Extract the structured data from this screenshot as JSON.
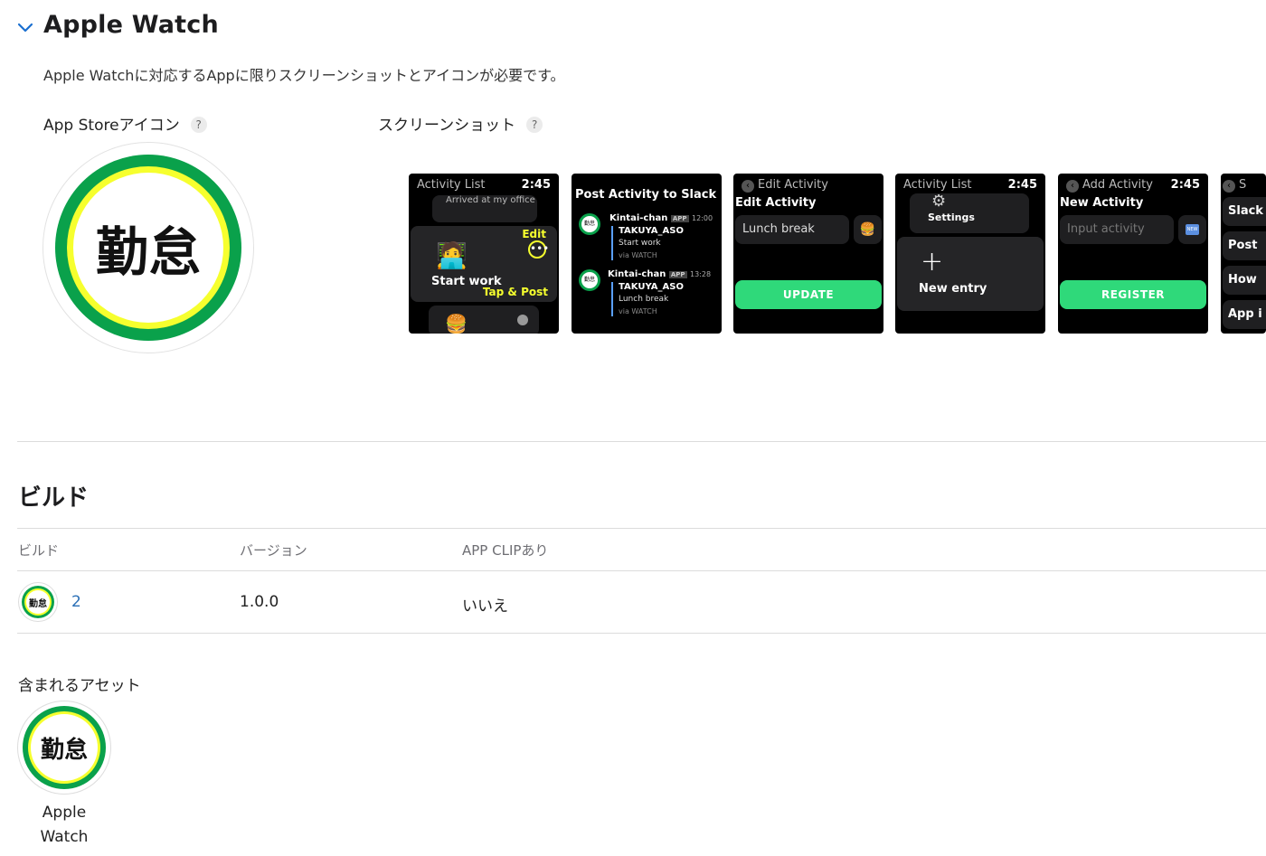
{
  "section": {
    "title": "Apple Watch",
    "description": "Apple Watchに対応するAppに限りスクリーンショットとアイコンが必要です。",
    "app_store_icon_label": "App Storeアイコン",
    "screenshots_label": "スクリーンショット",
    "help": "?"
  },
  "icon": {
    "glyphs": "勤怠",
    "colors": {
      "ring": "#0aa14b",
      "glow": "#f6ff2e"
    }
  },
  "screenshots": [
    {
      "title": "Activity List",
      "time": "2:45",
      "card_top": "Arrived at my office",
      "edit": "Edit",
      "main": "Start work",
      "tap": "Tap & Post"
    },
    {
      "header": "Post Activity to Slack",
      "messages": [
        {
          "sender": "Kintai-chan",
          "badge": "APP",
          "time": "12:00",
          "user": "TAKUYA_ASO",
          "text": "Start work",
          "via": "via",
          "watch": "WATCH"
        },
        {
          "sender": "Kintai-chan",
          "badge": "APP",
          "time": "13:28",
          "user": "TAKUYA_ASO",
          "text": "Lunch break",
          "via": "via",
          "watch": "WATCH"
        }
      ]
    },
    {
      "title": "Edit Activity",
      "subtitle": "Edit Activity",
      "field": "Lunch break",
      "button": "UPDATE"
    },
    {
      "title": "Activity List",
      "time": "2:45",
      "item": "Settings",
      "new_entry": "New entry",
      "plus": "+"
    },
    {
      "title": "Add Activity",
      "time": "2:45",
      "subtitle": "New Activity",
      "field": "Input activity",
      "new_badge": "NEW",
      "button": "REGISTER"
    },
    {
      "items": [
        "Slack",
        "Post",
        "How",
        "App i"
      ],
      "title_partial": "S"
    }
  ],
  "build": {
    "title": "ビルド",
    "headers": {
      "build": "ビルド",
      "version": "バージョン",
      "appclip": "APP CLIPあり"
    },
    "row": {
      "build_number": "2",
      "version": "1.0.0",
      "appclip": "いいえ"
    }
  },
  "assets": {
    "label": "含まれるアセット",
    "name": "Apple Watch"
  }
}
